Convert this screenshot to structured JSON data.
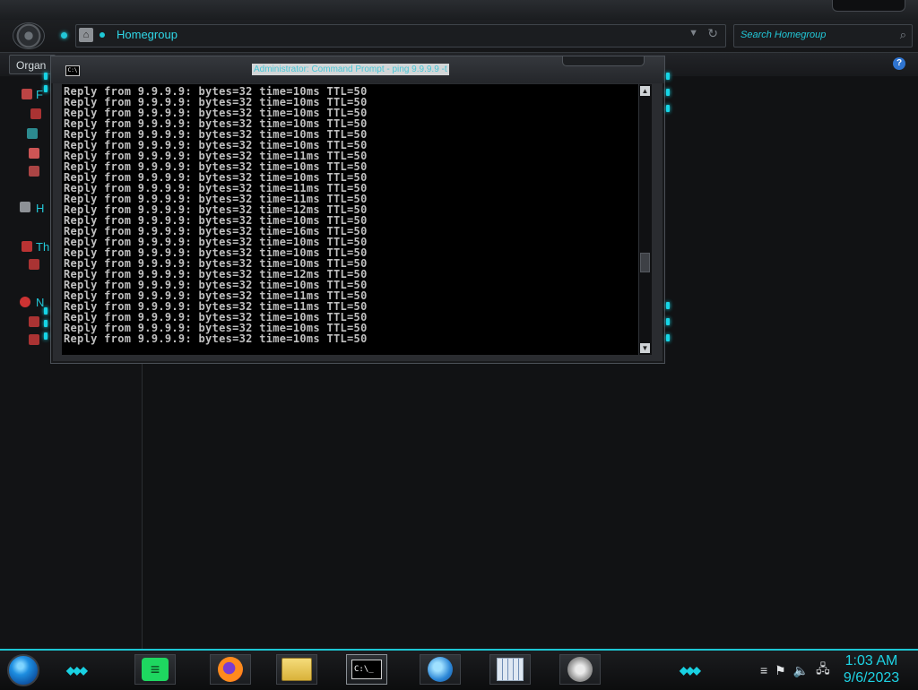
{
  "explorer": {
    "address": "Homegroup",
    "search_placeholder": "Search Homegroup",
    "organize_label": "Organ",
    "help_label": "?",
    "nav_items": [
      {
        "label": "F"
      },
      {
        "label": "H"
      },
      {
        "label": "Th"
      },
      {
        "label": "N"
      }
    ]
  },
  "cmd": {
    "title": "Administrator: Command Prompt - ping  9.9.9.9 -t",
    "icon_text": "C:\\",
    "lines": [
      "Reply from 9.9.9.9: bytes=32 time=10ms TTL=50",
      "Reply from 9.9.9.9: bytes=32 time=10ms TTL=50",
      "Reply from 9.9.9.9: bytes=32 time=10ms TTL=50",
      "Reply from 9.9.9.9: bytes=32 time=10ms TTL=50",
      "Reply from 9.9.9.9: bytes=32 time=10ms TTL=50",
      "Reply from 9.9.9.9: bytes=32 time=10ms TTL=50",
      "Reply from 9.9.9.9: bytes=32 time=11ms TTL=50",
      "Reply from 9.9.9.9: bytes=32 time=10ms TTL=50",
      "Reply from 9.9.9.9: bytes=32 time=10ms TTL=50",
      "Reply from 9.9.9.9: bytes=32 time=11ms TTL=50",
      "Reply from 9.9.9.9: bytes=32 time=11ms TTL=50",
      "Reply from 9.9.9.9: bytes=32 time=12ms TTL=50",
      "Reply from 9.9.9.9: bytes=32 time=10ms TTL=50",
      "Reply from 9.9.9.9: bytes=32 time=16ms TTL=50",
      "Reply from 9.9.9.9: bytes=32 time=10ms TTL=50",
      "Reply from 9.9.9.9: bytes=32 time=10ms TTL=50",
      "Reply from 9.9.9.9: bytes=32 time=10ms TTL=50",
      "Reply from 9.9.9.9: bytes=32 time=12ms TTL=50",
      "Reply from 9.9.9.9: bytes=32 time=10ms TTL=50",
      "Reply from 9.9.9.9: bytes=32 time=11ms TTL=50",
      "Reply from 9.9.9.9: bytes=32 time=11ms TTL=50",
      "Reply from 9.9.9.9: bytes=32 time=10ms TTL=50",
      "Reply from 9.9.9.9: bytes=32 time=10ms TTL=50",
      "Reply from 9.9.9.9: bytes=32 time=10ms TTL=50"
    ]
  },
  "taskbar": {
    "apps": [
      {
        "name": "spotify",
        "icon": "spotify-icon"
      },
      {
        "name": "firefox",
        "icon": "firefox-icon"
      },
      {
        "name": "file-explorer",
        "icon": "folder-icon"
      },
      {
        "name": "command-prompt",
        "icon": "cmd-icon",
        "icon_text": "C:\\_"
      },
      {
        "name": "network",
        "icon": "globe-icon"
      },
      {
        "name": "calendar",
        "icon": "calendar-icon"
      },
      {
        "name": "volume-app",
        "icon": "speaker-icon"
      }
    ],
    "clock": {
      "time": "1:03 AM",
      "date": "9/6/2023"
    }
  },
  "colors": {
    "accent": "#1dc6d4",
    "console_bg": "#000000",
    "console_text": "#c0c0c0"
  }
}
